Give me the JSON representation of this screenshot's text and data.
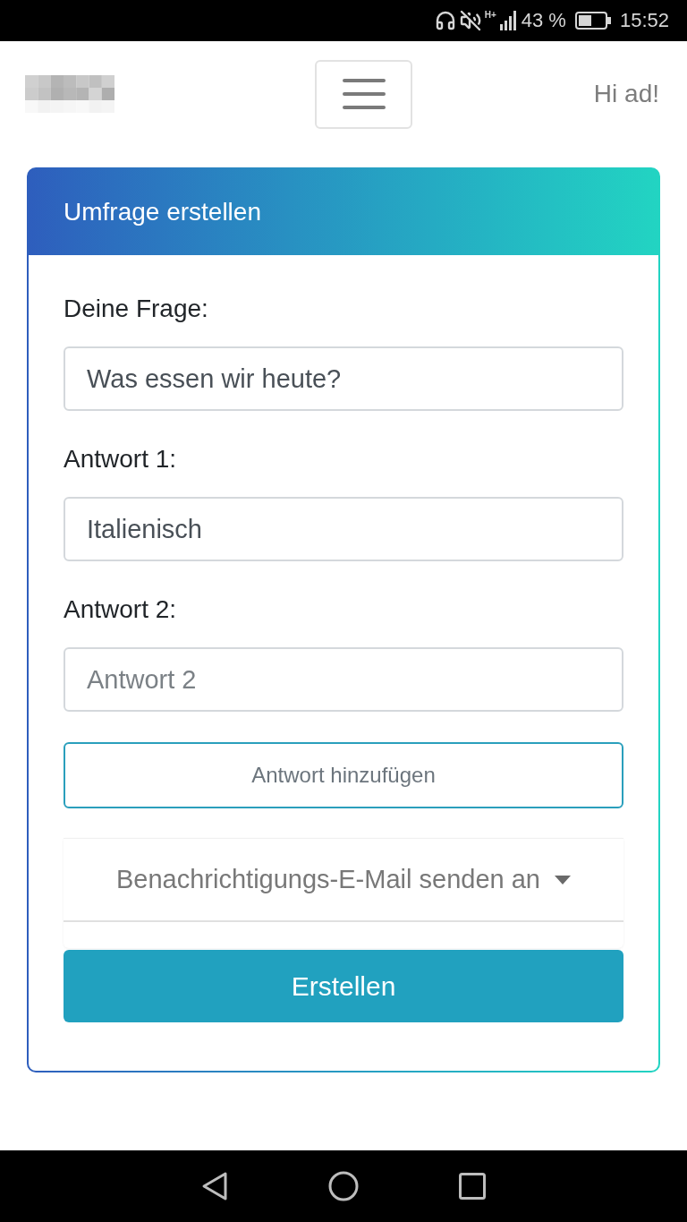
{
  "status_bar": {
    "network_type": "H+",
    "battery": "43 %",
    "time": "15:52"
  },
  "header": {
    "greeting": "Hi ad!"
  },
  "card": {
    "title": "Umfrage erstellen",
    "fields": [
      {
        "label": "Deine Frage:",
        "value": "Was essen wir heute?"
      },
      {
        "label": "Antwort 1:",
        "value": "Italienisch"
      },
      {
        "label": "Antwort 2:",
        "placeholder": "Antwort 2"
      }
    ],
    "add_button": "Antwort hinzufügen",
    "notify_dropdown": {
      "placeholder": "Benachrichtigungs-E-Mail senden an"
    },
    "submit_button": "Erstellen"
  }
}
